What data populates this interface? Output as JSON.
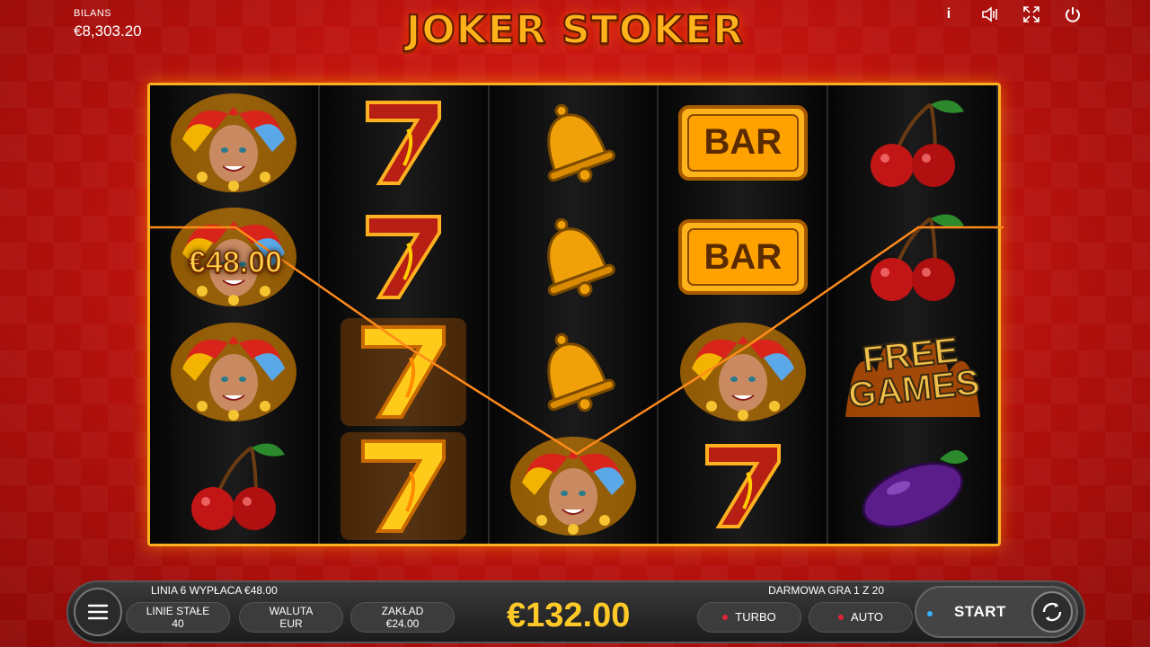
{
  "game": {
    "title": "JOKER STOKER",
    "balance_label": "BILANS",
    "balance_value": "€8,303.20"
  },
  "top_icons": [
    "info-icon",
    "sound-icon",
    "fullscreen-icon",
    "power-icon"
  ],
  "top_icon_glyphs": {
    "info": "i",
    "sound": "◁)",
    "fullscreen": "⤢",
    "power": "⏻"
  },
  "reels": [
    [
      "joker",
      "joker",
      "joker",
      "cherry"
    ],
    [
      "seven",
      "seven",
      "seven-gold",
      "seven-gold"
    ],
    [
      "bell",
      "bell",
      "bell",
      "joker"
    ],
    [
      "bar",
      "bar",
      "joker",
      "seven"
    ],
    [
      "cherry",
      "cherry",
      "free-games",
      "plum"
    ]
  ],
  "symbols": {
    "bar_text": "BAR",
    "seven_text": "7",
    "free_text_1": "FREE",
    "free_text_2": "GAMES"
  },
  "win": {
    "amount": "€48.00"
  },
  "bottom": {
    "line_info": "LINIA 6 WYPŁACA €48.00",
    "free_games_info": "DARMOWA GRA 1 Z 20",
    "lines_label": "LINIE STAŁE",
    "lines_value": "40",
    "currency_label": "WALUTA",
    "currency_value": "EUR",
    "bet_label": "ZAKŁAD",
    "bet_value": "€24.00",
    "total_win": "€132.00",
    "turbo_label": "TURBO",
    "auto_label": "AUTO",
    "start_label": "START"
  },
  "colors": {
    "background": "#c2140f",
    "gold": "#ffb020",
    "win_text": "#ffca28",
    "turbo_dot": "#e0243a",
    "auto_dot": "#e0243a",
    "start_dot": "#3ab0ff"
  }
}
